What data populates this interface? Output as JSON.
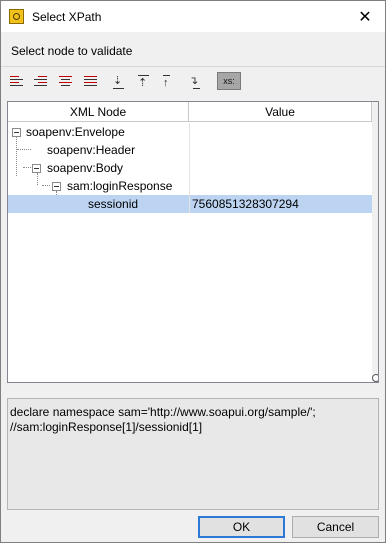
{
  "window": {
    "title": "Select XPath",
    "close_glyph": "✕"
  },
  "header": {
    "instruction": "Select node to validate"
  },
  "toolbar": {
    "buttons": [
      {
        "name": "expand-all",
        "icon": "align-left-red-icon"
      },
      {
        "name": "collapse-all",
        "icon": "align-right-red-icon"
      },
      {
        "name": "align-center",
        "icon": "align-center-red-icon"
      },
      {
        "name": "align-justify",
        "icon": "align-justify-red-icon"
      },
      {
        "name": "move-bottom",
        "icon": "arrow-to-bottom-icon"
      },
      {
        "name": "move-top",
        "icon": "arrow-to-top-icon"
      },
      {
        "name": "move-up",
        "icon": "arrow-up-icon"
      },
      {
        "name": "move-down",
        "icon": "arrow-down-right-icon"
      }
    ],
    "xs_label": "xs:"
  },
  "tree": {
    "columns": {
      "node": "XML Node",
      "value": "Value"
    },
    "rows": [
      {
        "label": "soapenv:Envelope",
        "value": ""
      },
      {
        "label": "soapenv:Header",
        "value": ""
      },
      {
        "label": "soapenv:Body",
        "value": ""
      },
      {
        "label": "sam:loginResponse",
        "value": ""
      },
      {
        "label": "sessionid",
        "value": "7560851328307294",
        "selected": true
      }
    ]
  },
  "xpath": {
    "line1": "declare namespace sam='http://www.soapui.org/sample/';",
    "line2": "//sam:loginResponse[1]/sessionid[1]"
  },
  "buttons": {
    "ok": "OK",
    "cancel": "Cancel"
  }
}
